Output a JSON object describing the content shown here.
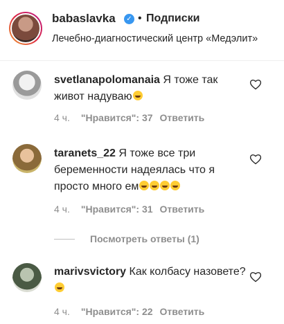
{
  "header": {
    "username": "babaslavka",
    "dot": "•",
    "follow_label": "Подписки",
    "location": "Лечебно-диагностический центр «Медэлит»"
  },
  "comments": [
    {
      "username": "svetlanapolomanaia",
      "text": "Я тоже так живот надуваю",
      "emoji_count": 1,
      "time": "4 ч.",
      "likes": "\"Нравится\": 37",
      "reply": "Ответить"
    },
    {
      "username": "taranets_22",
      "text": "Я тоже все три беременности надеялась что я просто много ем",
      "emoji_count": 4,
      "time": "4 ч.",
      "likes": "\"Нравится\": 31",
      "reply": "Ответить"
    },
    {
      "username": "marivsvictory",
      "text": "Как колбасу назовете?",
      "emoji_count": 1,
      "time": "4 ч.",
      "likes": "\"Нравится\": 22",
      "reply": "Ответить"
    }
  ],
  "replies": {
    "label": "Посмотреть ответы (1)"
  },
  "colors": {
    "verified": "#3897f0",
    "meta": "#8e8e8e"
  }
}
